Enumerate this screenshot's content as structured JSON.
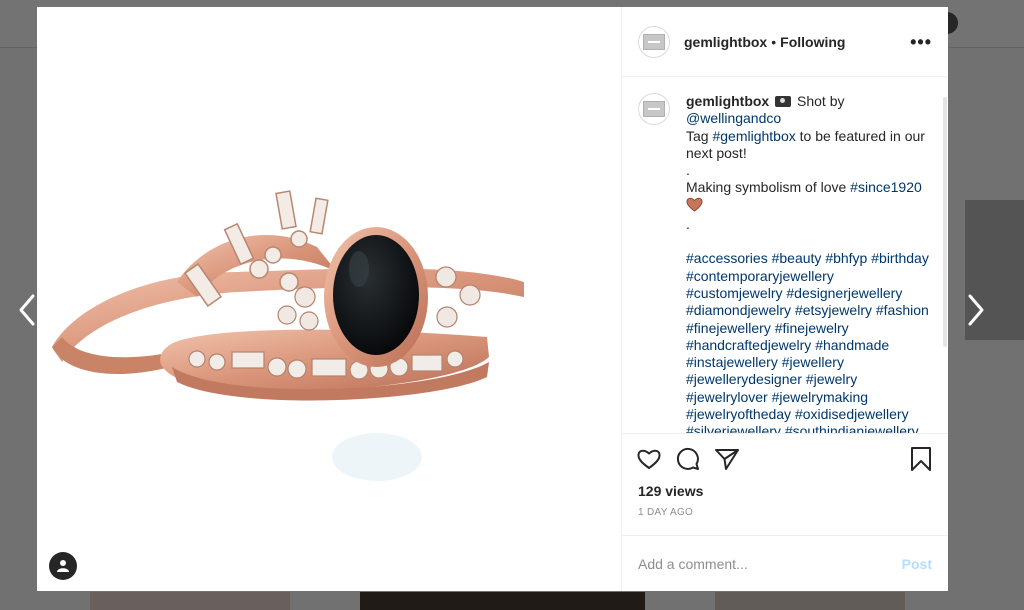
{
  "post": {
    "username": "gemlightbox",
    "separator": "•",
    "follow_status": "Following",
    "more_icon": "more-horizontal-icon",
    "views": "129 views",
    "time": "1 DAY AGO"
  },
  "caption": {
    "username": "gemlightbox",
    "shot_by": "Shot by",
    "mention": "@wellingandco",
    "tag_prefix": "Tag",
    "tag_hashtag": "#gemlightbox",
    "tag_suffix": "to be featured in our next post!",
    "dot1": ".",
    "symbolism_text": "Making symbolism of love",
    "symbolism_hashtag": "#since1920",
    "dot2": ".",
    "hashtags": [
      "#accessories",
      "#beauty",
      "#bhfyp",
      "#birthday",
      "#contemporaryjewellery",
      "#customjewelry",
      "#designerjewellery",
      "#diamondjewelry",
      "#etsyjewelry",
      "#fashion",
      "#finejewellery",
      "#finejewelry",
      "#handcraftedjewelry",
      "#handmade",
      "#instajewellery",
      "#jewellery",
      "#jewellerydesigner",
      "#jewelry",
      "#jewelrylover",
      "#jewelrymaking",
      "#jewelryoftheday",
      "#oxidisedjewellery",
      "#silverjewellery",
      "#southindianjewellery"
    ]
  },
  "comment": {
    "placeholder": "Add a comment...",
    "post_label": "Post"
  },
  "colors": {
    "link": "#00376b",
    "post_button_disabled": "#b2dffc",
    "text": "#262626",
    "muted": "#8e8e8e"
  }
}
